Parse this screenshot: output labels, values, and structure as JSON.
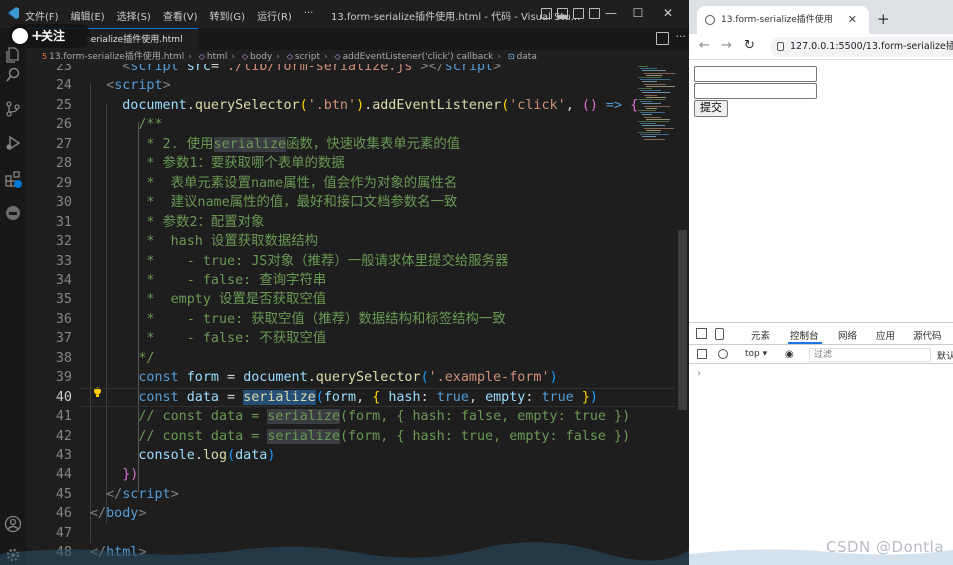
{
  "vscode": {
    "menu": [
      "文件(F)",
      "编辑(E)",
      "选择(S)",
      "查看(V)",
      "转到(G)",
      "运行(R)",
      "···"
    ],
    "window_title": "13.form-serialize插件使用.html - 代码 - Visual Stu...",
    "window_controls": {
      "minimize": "—",
      "maximize": "☐",
      "close": "✕"
    },
    "tab_label": "serialize插件使用.html",
    "follow_button": "关注",
    "breadcrumb": [
      {
        "label": "13.form-serialize插件使用.html",
        "icon": "html-file-icon"
      },
      {
        "label": "html",
        "icon": "element-icon"
      },
      {
        "label": "body",
        "icon": "element-icon"
      },
      {
        "label": "script",
        "icon": "element-icon"
      },
      {
        "label": "addEventListener('click') callback",
        "icon": "element-icon"
      },
      {
        "label": "data",
        "icon": "variable-icon"
      }
    ],
    "active_line": "40",
    "lines": [
      {
        "n": "23",
        "tokens": [
          [
            "    ",
            "plain"
          ],
          [
            "<",
            "punc"
          ],
          [
            "script",
            "tag"
          ],
          [
            " src",
            "var"
          ],
          [
            "=",
            "plain"
          ],
          [
            "\"./lib/form-serialize.js\"",
            "str"
          ],
          [
            "></",
            "punc"
          ],
          [
            "script",
            "tag"
          ],
          [
            ">",
            "punc"
          ]
        ]
      },
      {
        "n": "24",
        "tokens": [
          [
            "  ",
            "plain"
          ],
          [
            "<",
            "punc"
          ],
          [
            "script",
            "tag"
          ],
          [
            ">",
            "punc"
          ]
        ]
      },
      {
        "n": "25",
        "tokens": [
          [
            "    ",
            "plain"
          ],
          [
            "document",
            "var"
          ],
          [
            ".",
            "plain"
          ],
          [
            "querySelector",
            "fn"
          ],
          [
            "(",
            "br1"
          ],
          [
            "'.btn'",
            "str"
          ],
          [
            ")",
            "br1"
          ],
          [
            ".",
            "plain"
          ],
          [
            "addEventListener",
            "fn"
          ],
          [
            "(",
            "br1"
          ],
          [
            "'click'",
            "str"
          ],
          [
            ", ",
            "plain"
          ],
          [
            "()",
            "br2"
          ],
          [
            " ",
            "plain"
          ],
          [
            "=>",
            "kw"
          ],
          [
            " ",
            "plain"
          ],
          [
            "{",
            "br2"
          ]
        ]
      },
      {
        "n": "26",
        "tokens": [
          [
            "      ",
            "plain"
          ],
          [
            "/**",
            "cm"
          ]
        ]
      },
      {
        "n": "27",
        "tokens": [
          [
            "       * 2. 使用",
            "cm"
          ],
          [
            "serialize",
            "cm",
            "occ"
          ],
          [
            "函数，快速收集表单元素的值",
            "cm"
          ]
        ]
      },
      {
        "n": "28",
        "tokens": [
          [
            "       * 参数1：要获取哪个表单的数据",
            "cm"
          ]
        ]
      },
      {
        "n": "29",
        "tokens": [
          [
            "       *  表单元素设置name属性，值会作为对象的属性名",
            "cm"
          ]
        ]
      },
      {
        "n": "30",
        "tokens": [
          [
            "       *  建议name属性的值，最好和接口文档参数名一致",
            "cm"
          ]
        ]
      },
      {
        "n": "31",
        "tokens": [
          [
            "       * 参数2：配置对象",
            "cm"
          ]
        ]
      },
      {
        "n": "32",
        "tokens": [
          [
            "       *  hash 设置获取数据结构",
            "cm"
          ]
        ]
      },
      {
        "n": "33",
        "tokens": [
          [
            "       *    - true: JS对象（推荐）一般请求体里提交给服务器",
            "cm"
          ]
        ]
      },
      {
        "n": "34",
        "tokens": [
          [
            "       *    - false: 查询字符串",
            "cm"
          ]
        ]
      },
      {
        "n": "35",
        "tokens": [
          [
            "       *  empty 设置是否获取空值",
            "cm"
          ]
        ]
      },
      {
        "n": "36",
        "tokens": [
          [
            "       *    - true: 获取空值（推荐）数据结构和标签结构一致",
            "cm"
          ]
        ]
      },
      {
        "n": "37",
        "tokens": [
          [
            "       *    - false: 不获取空值",
            "cm"
          ]
        ]
      },
      {
        "n": "38",
        "tokens": [
          [
            "      ",
            "plain"
          ],
          [
            "*/",
            "cm"
          ]
        ]
      },
      {
        "n": "39",
        "tokens": [
          [
            "      ",
            "plain"
          ],
          [
            "const",
            "kw"
          ],
          [
            " ",
            "plain"
          ],
          [
            "form",
            "var"
          ],
          [
            " = ",
            "plain"
          ],
          [
            "document",
            "var"
          ],
          [
            ".",
            "plain"
          ],
          [
            "querySelector",
            "fn"
          ],
          [
            "(",
            "br3"
          ],
          [
            "'.example-form'",
            "str"
          ],
          [
            ")",
            "br3"
          ]
        ]
      },
      {
        "n": "40",
        "tokens": [
          [
            "      ",
            "plain"
          ],
          [
            "const",
            "kw"
          ],
          [
            " ",
            "plain"
          ],
          [
            "data",
            "var"
          ],
          [
            " = ",
            "plain"
          ],
          [
            "serialize",
            "fn",
            "sel"
          ],
          [
            "(",
            "br3"
          ],
          [
            "form",
            "var"
          ],
          [
            ", ",
            "plain"
          ],
          [
            "{",
            "br1"
          ],
          [
            " ",
            "plain"
          ],
          [
            "hash",
            "var"
          ],
          [
            ": ",
            "plain"
          ],
          [
            "true",
            "kw"
          ],
          [
            ", ",
            "plain"
          ],
          [
            "empty",
            "var"
          ],
          [
            ": ",
            "plain"
          ],
          [
            "true",
            "kw"
          ],
          [
            " ",
            "plain"
          ],
          [
            "}",
            "br1"
          ],
          [
            ")",
            "br3"
          ]
        ]
      },
      {
        "n": "41",
        "tokens": [
          [
            "      // const data = ",
            "cm"
          ],
          [
            "serialize",
            "cm",
            "occ"
          ],
          [
            "(form, { hash: false, empty: true })",
            "cm"
          ]
        ]
      },
      {
        "n": "42",
        "tokens": [
          [
            "      // const data = ",
            "cm"
          ],
          [
            "serialize",
            "cm",
            "occ"
          ],
          [
            "(form, { hash: true, empty: false })",
            "cm"
          ]
        ]
      },
      {
        "n": "43",
        "tokens": [
          [
            "      ",
            "plain"
          ],
          [
            "console",
            "var"
          ],
          [
            ".",
            "plain"
          ],
          [
            "log",
            "fn"
          ],
          [
            "(",
            "br3"
          ],
          [
            "data",
            "var"
          ],
          [
            ")",
            "br3"
          ]
        ]
      },
      {
        "n": "44",
        "tokens": [
          [
            "    ",
            "plain"
          ],
          [
            "})",
            "br2"
          ]
        ]
      },
      {
        "n": "45",
        "tokens": [
          [
            "  ",
            "plain"
          ],
          [
            "</",
            "punc"
          ],
          [
            "script",
            "tag"
          ],
          [
            ">",
            "punc"
          ]
        ]
      },
      {
        "n": "46",
        "tokens": [
          [
            "",
            "plain"
          ],
          [
            "</",
            "punc"
          ],
          [
            "body",
            "tag"
          ],
          [
            ">",
            "punc"
          ]
        ]
      },
      {
        "n": "47",
        "tokens": [
          [
            "",
            "plain"
          ]
        ]
      },
      {
        "n": "48",
        "tokens": [
          [
            "",
            "plain"
          ],
          [
            "</",
            "punc"
          ],
          [
            "html",
            "tag"
          ],
          [
            ">",
            "punc"
          ]
        ]
      }
    ]
  },
  "browser": {
    "tab_title": "13.form-serialize插件使用",
    "tab_close": "✕",
    "new_tab": "+",
    "nav": {
      "back": "←",
      "forward": "→",
      "reload": "↻"
    },
    "url": "127.0.0.1:5500/13.form-serialize插",
    "page": {
      "submit_label": "提交"
    },
    "devtools": {
      "tabs": [
        "元素",
        "控制台",
        "网络",
        "应用",
        "源代码"
      ],
      "active_tab": "控制台",
      "context": "top ▾",
      "filter_placeholder": "过滤",
      "default_levels": "默认",
      "prompt": "›"
    }
  },
  "watermark": "CSDN @Dontla",
  "colors": {
    "editor_bg": "#1e1e1e",
    "accent": "#0078d4",
    "devtools_active": "#1a73e8"
  }
}
